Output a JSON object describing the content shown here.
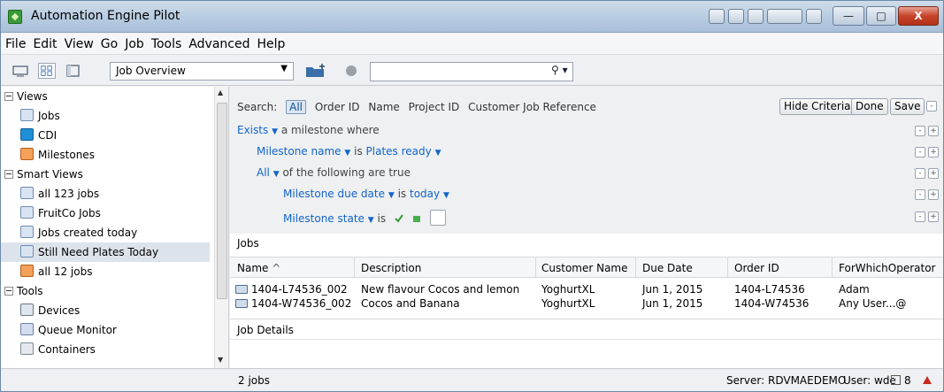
{
  "window": {
    "title": "Automation Engine Pilot"
  },
  "menu": [
    "File",
    "Edit",
    "View",
    "Go",
    "Job",
    "Tools",
    "Advanced",
    "Help"
  ],
  "toolbar": {
    "view_selector": "Job Overview",
    "search_value": ""
  },
  "tree": {
    "views_header": "Views",
    "views": [
      "Jobs",
      "CDI",
      "Milestones"
    ],
    "smart_views_header": "Smart Views",
    "smart_views": [
      "all 123 jobs",
      "FruitCo Jobs",
      "Jobs created today",
      "Still Need Plates Today",
      "all 12 jobs"
    ],
    "selected_smart_view": "Still Need Plates Today",
    "tools_header": "Tools",
    "tools": [
      "Devices",
      "Queue Monitor",
      "Containers"
    ]
  },
  "criteria": {
    "search_label": "Search:",
    "search_options": [
      "All",
      "Order ID",
      "Name",
      "Project ID",
      "Customer Job Reference"
    ],
    "hide_criteria": "Hide Criteria",
    "done": "Done",
    "save": "Save",
    "row1": {
      "keyword": "Exists",
      "text": "a milestone where"
    },
    "row2": {
      "field": "Milestone name",
      "op": "is",
      "value": "Plates ready"
    },
    "row3": {
      "keyword": "All",
      "text": "of the following are true"
    },
    "row4": {
      "field": "Milestone due date",
      "op": "is",
      "value": "today"
    },
    "row5": {
      "field": "Milestone state",
      "op": "is"
    }
  },
  "jobs": {
    "label": "Jobs",
    "columns": [
      "Name",
      "Description",
      "Customer Name",
      "Due Date",
      "Order ID",
      "ForWhichOperator"
    ],
    "sort_indicator": "^",
    "rows": [
      [
        "1404-L74536_002",
        "New flavour Cocos and lemon",
        "YoghurtXL",
        "Jun 1, 2015",
        "1404-L74536",
        "Adam"
      ],
      [
        "1404-W74536_002",
        "Cocos and Banana",
        "YoghurtXL",
        "Jun 1, 2015",
        "1404-W74536",
        "Any User...@"
      ]
    ]
  },
  "details": {
    "label": "Job Details"
  },
  "status": {
    "count": "2 jobs",
    "server": "Server: RDVMAEDEMO",
    "user": "User: wde",
    "notifications": "8"
  },
  "colors": {
    "link_blue": "#1264c9",
    "selected_row": "#dde3ea",
    "title_gradient_top": "#cfdcea"
  },
  "icons": [
    "app-icon",
    "job-icon",
    "cdi-icon",
    "milestone-icon",
    "device-icon",
    "queue-icon",
    "container-icon",
    "folder-icon",
    "search-icon"
  ]
}
